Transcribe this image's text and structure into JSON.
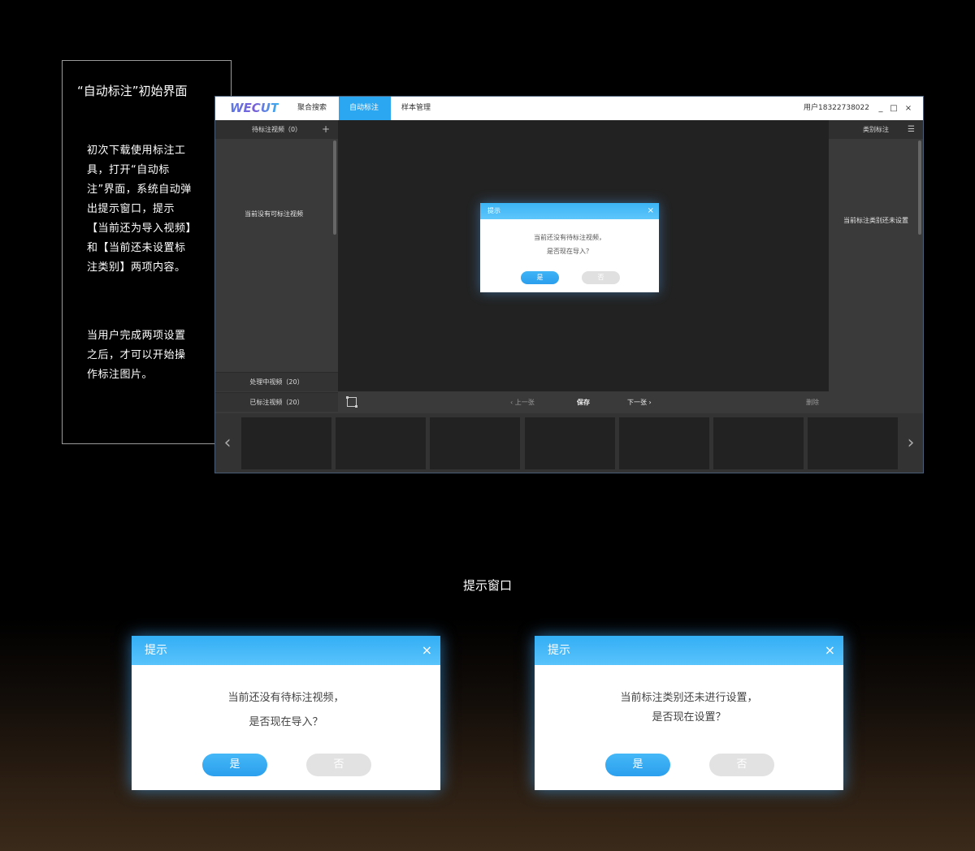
{
  "description": {
    "title": "“自动标注”初始界面",
    "paragraph1": "初次下载使用标注工具，打开“自动标注”界面，系统自动弹出提示窗口，提示【当前还为导入视频】和【当前还未设置标注类别】两项内容。",
    "paragraph2": "当用户完成两项设置之后，才可以开始操作标注图片。"
  },
  "app": {
    "logo": "WECUT",
    "nav_tabs": [
      {
        "label": "聚合搜索",
        "active": false
      },
      {
        "label": "自动标注",
        "active": true
      },
      {
        "label": "样本管理",
        "active": false
      }
    ],
    "user_label": "用户18322738022",
    "window_controls": {
      "minimize": "_",
      "maximize": "□",
      "close": "×"
    },
    "left_panel": {
      "header": "待标注视频（0）",
      "add_icon": "+",
      "empty_text": "当前没有可标注视频",
      "processing": "处理中视频（20）",
      "done": "已标注视频（20）"
    },
    "toolbar": {
      "prev": "上一张",
      "save": "保存",
      "next": "下一张",
      "delete": "删除"
    },
    "right_panel": {
      "header": "类别标注",
      "menu_icon": "☰",
      "empty_text": "当前标注类别还未设置"
    },
    "filmstrip": {
      "thumb_count_visible": 7,
      "prev_icon": "‹",
      "next_icon": "›"
    },
    "mini_dialog": {
      "title": "提示",
      "close": "×",
      "line1": "当前还没有待标注视频，",
      "line2": "是否现在导入？",
      "yes": "是",
      "no": "否"
    }
  },
  "caption": "提示窗口",
  "dialogs": [
    {
      "title": "提示",
      "close": "×",
      "line1": "当前还没有待标注视频，",
      "line2": "是否现在导入？",
      "yes": "是",
      "no": "否"
    },
    {
      "title": "提示",
      "close": "×",
      "line1": "当前标注类别还未进行设置，",
      "line2": "是否现在设置？",
      "yes": "是",
      "no": "否"
    }
  ],
  "colors": {
    "accent": "#2aa7f0",
    "dialog_header": "#3bb4f5",
    "panel_dark": "#3a3a3a",
    "canvas": "#222222"
  }
}
